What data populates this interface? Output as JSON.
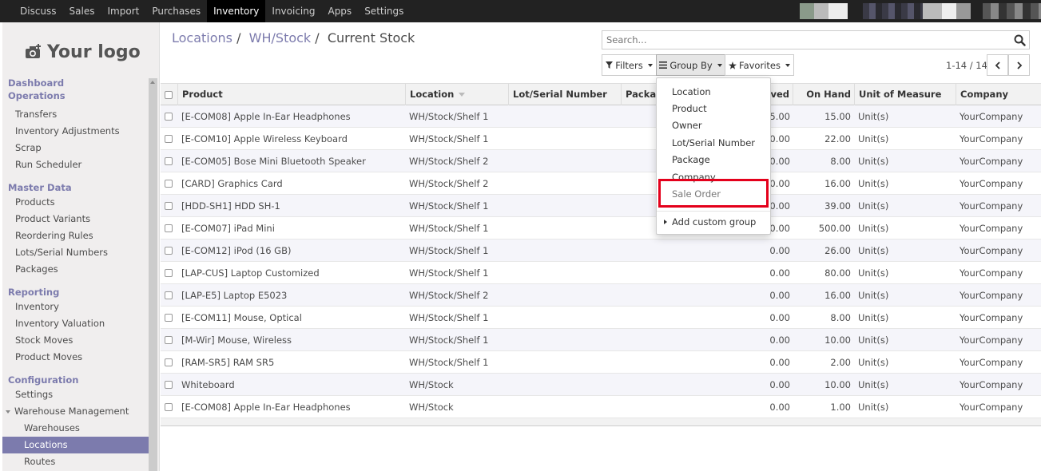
{
  "topbar": {
    "menu": [
      "Discuss",
      "Sales",
      "Import",
      "Purchases",
      "Inventory",
      "Invoicing",
      "Apps",
      "Settings"
    ],
    "active_index": 4
  },
  "sidebar": {
    "logo_text": "Your logo",
    "sections": [
      {
        "title": "Dashboard",
        "items": []
      },
      {
        "title": "Operations",
        "items": [
          "Transfers",
          "Inventory Adjustments",
          "Scrap",
          "Run Scheduler"
        ]
      },
      {
        "title": "Master Data",
        "items": [
          "Products",
          "Product Variants",
          "Reordering Rules",
          "Lots/Serial Numbers",
          "Packages"
        ]
      },
      {
        "title": "Reporting",
        "items": [
          "Inventory",
          "Inventory Valuation",
          "Stock Moves",
          "Product Moves"
        ]
      },
      {
        "title": "Configuration",
        "items": [
          "Settings"
        ]
      }
    ],
    "warehouse_group": "Warehouse Management",
    "warehouse_items": [
      "Warehouses",
      "Locations",
      "Routes"
    ],
    "active_item": "Locations"
  },
  "breadcrumb": {
    "crumb1": "Locations",
    "crumb2": "WH/Stock",
    "current": "Current Stock",
    "sep": "/"
  },
  "search": {
    "placeholder": "Search..."
  },
  "toolbar": {
    "filters": "Filters",
    "group_by": "Group By",
    "favorites": "Favorites"
  },
  "pager": {
    "text": "1-14 / 14"
  },
  "table": {
    "headers": {
      "product": "Product",
      "location": "Location",
      "lot": "Lot/Serial Number",
      "package": "Package",
      "reserved": "Reserved",
      "on_hand": "On Hand",
      "uom": "Unit of Measure",
      "company": "Company"
    },
    "rows": [
      {
        "product": "[E-COM08] Apple In-Ear Headphones",
        "location": "WH/Stock/Shelf 1",
        "reserved": "15.00",
        "on_hand": "15.00",
        "uom": "Unit(s)",
        "company": "YourCompany"
      },
      {
        "product": "[E-COM10] Apple Wireless Keyboard",
        "location": "WH/Stock/Shelf 1",
        "reserved": "0.00",
        "on_hand": "22.00",
        "uom": "Unit(s)",
        "company": "YourCompany"
      },
      {
        "product": "[E-COM05] Bose Mini Bluetooth Speaker",
        "location": "WH/Stock/Shelf 2",
        "reserved": "0.00",
        "on_hand": "8.00",
        "uom": "Unit(s)",
        "company": "YourCompany"
      },
      {
        "product": "[CARD] Graphics Card",
        "location": "WH/Stock/Shelf 2",
        "reserved": "0.00",
        "on_hand": "16.00",
        "uom": "Unit(s)",
        "company": "YourCompany"
      },
      {
        "product": "[HDD-SH1] HDD SH-1",
        "location": "WH/Stock/Shelf 1",
        "reserved": "0.00",
        "on_hand": "39.00",
        "uom": "Unit(s)",
        "company": "YourCompany"
      },
      {
        "product": "[E-COM07] iPad Mini",
        "location": "WH/Stock/Shelf 1",
        "reserved": "0.00",
        "on_hand": "500.00",
        "uom": "Unit(s)",
        "company": "YourCompany"
      },
      {
        "product": "[E-COM12] iPod (16 GB)",
        "location": "WH/Stock/Shelf 1",
        "reserved": "0.00",
        "on_hand": "26.00",
        "uom": "Unit(s)",
        "company": "YourCompany"
      },
      {
        "product": "[LAP-CUS] Laptop Customized",
        "location": "WH/Stock/Shelf 1",
        "reserved": "0.00",
        "on_hand": "80.00",
        "uom": "Unit(s)",
        "company": "YourCompany"
      },
      {
        "product": "[LAP-E5] Laptop E5023",
        "location": "WH/Stock/Shelf 2",
        "reserved": "0.00",
        "on_hand": "16.00",
        "uom": "Unit(s)",
        "company": "YourCompany"
      },
      {
        "product": "[E-COM11] Mouse, Optical",
        "location": "WH/Stock/Shelf 1",
        "reserved": "0.00",
        "on_hand": "8.00",
        "uom": "Unit(s)",
        "company": "YourCompany"
      },
      {
        "product": "[M-Wir] Mouse, Wireless",
        "location": "WH/Stock/Shelf 1",
        "reserved": "0.00",
        "on_hand": "10.00",
        "uom": "Unit(s)",
        "company": "YourCompany"
      },
      {
        "product": "[RAM-SR5] RAM SR5",
        "location": "WH/Stock/Shelf 1",
        "reserved": "0.00",
        "on_hand": "2.00",
        "uom": "Unit(s)",
        "company": "YourCompany"
      },
      {
        "product": "Whiteboard",
        "location": "WH/Stock",
        "reserved": "0.00",
        "on_hand": "10.00",
        "uom": "Unit(s)",
        "company": "YourCompany"
      },
      {
        "product": "[E-COM08] Apple In-Ear Headphones",
        "location": "WH/Stock",
        "reserved": "0.00",
        "on_hand": "1.00",
        "uom": "Unit(s)",
        "company": "YourCompany"
      }
    ]
  },
  "groupby_menu": {
    "items": [
      "Location",
      "Product",
      "Owner",
      "Lot/Serial Number",
      "Package",
      "Company",
      "Sale Order"
    ],
    "add_custom": "Add custom group"
  },
  "colors": {
    "accent": "#7c7bad",
    "topbar": "#222222",
    "highlight": "#e4001b"
  }
}
